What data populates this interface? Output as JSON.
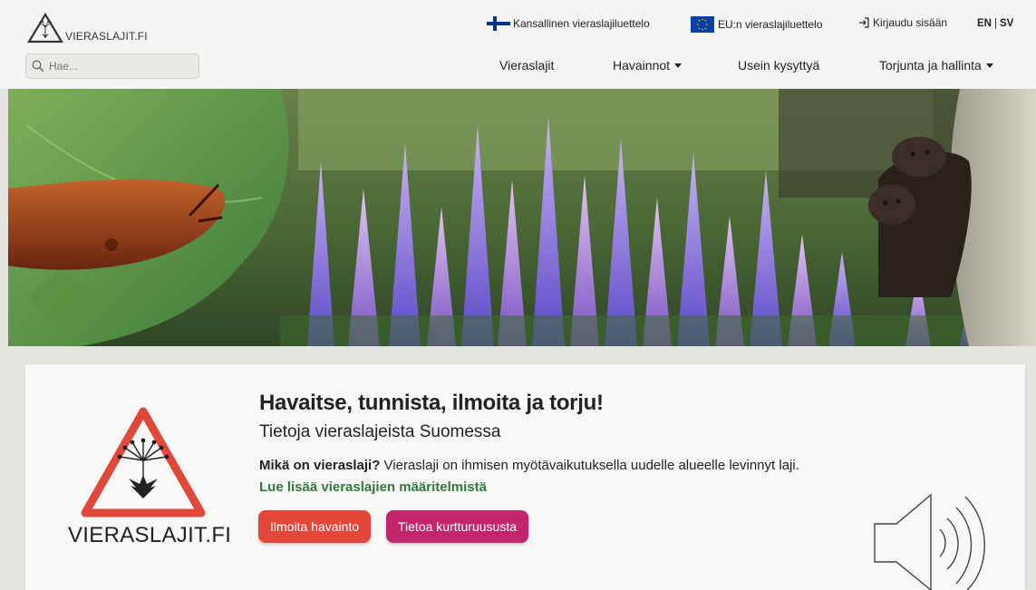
{
  "header": {
    "logo_text": "VIERASLAJIT.FI",
    "search_placeholder": "Hae...",
    "top_links": {
      "national_list": "Kansallinen vieraslajiluettelo",
      "eu_list": "EU:n vieraslajiluettelo",
      "login": "Kirjaudu sisään",
      "lang_en": "EN",
      "lang_sep": "|",
      "lang_sv": "SV"
    },
    "nav": [
      {
        "label": "Vieraslajit"
      },
      {
        "label": "Havainnot"
      },
      {
        "label": "Usein kysyttyä"
      },
      {
        "label": "Torjunta ja hallinta"
      }
    ]
  },
  "card": {
    "logo_text": "VIERASLAJIT.FI",
    "headline": "Havaitse, tunnista, ilmoita ja torju!",
    "subheadline": "Tietoja vieraslajeista Suomessa",
    "question": "Mikä on vieraslaji?",
    "answer": " Vieraslaji on ihmisen myötävaikutuksella uudelle alueelle levinnyt laji. ",
    "read_more": "Lue lisää vieraslajien määritelmistä",
    "buttons": {
      "report": "Ilmoita havainto",
      "info": "Tietoa kurtturuususta"
    }
  },
  "colors": {
    "report_button": "#e2483a",
    "info_button": "#c4266e",
    "link_green": "#2f7a3a",
    "logo_red": "#e2483a"
  },
  "icons": {
    "search": "search-icon",
    "finnish_flag": "finland-flag-icon",
    "eu_flag": "eu-flag-icon",
    "login": "login-icon",
    "speaker": "speaker-icon"
  }
}
